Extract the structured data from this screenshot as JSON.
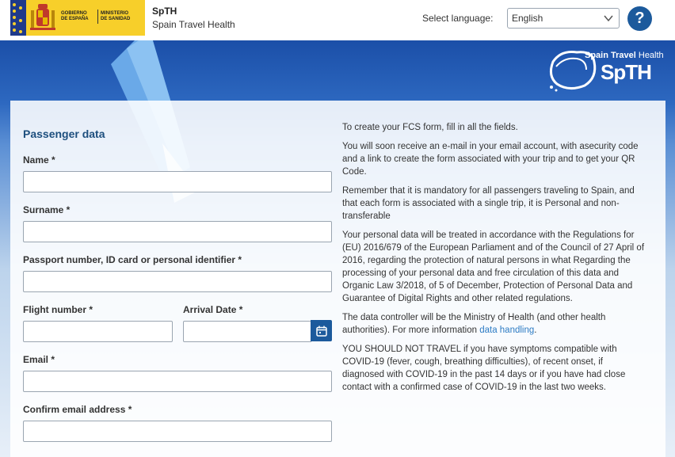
{
  "header": {
    "gov_logo_line1": "GOBIERNO\nDE ESPAÑA",
    "gov_logo_line2": "MINISTERIO\nDE SANIDAD",
    "app_title": "SpTH",
    "app_subtitle": "Spain Travel Health",
    "language_label": "Select language:",
    "language_value": "English",
    "help_label": "?"
  },
  "brand": {
    "top_bold": "Spain Travel",
    "top_light": "Health",
    "main": "SpTH"
  },
  "form": {
    "section_title": "Passenger data",
    "fields": {
      "name": "Name *",
      "surname": "Surname *",
      "passport": "Passport number, ID card or personal identifier *",
      "flight_number": "Flight number *",
      "arrival_date": "Arrival Date *",
      "email": "Email *",
      "confirm_email": "Confirm email address *"
    }
  },
  "info": {
    "p1": "To create your FCS form, fill in all the fields.",
    "p2": "You will soon receive an e-mail in your email account, with asecurity code and a link to create the form associated with your trip and to get your QR Code.",
    "p3": "Remember that it is mandatory for all passengers traveling to Spain, and that each form is associated with a single trip, it is Personal and non-transferable",
    "p4": "Your personal data will be treated in accordance with the Regulations for (EU) 2016/679 of the European Parliament and of the Council of 27 April of 2016, regarding the protection of natural persons in what Regarding the processing of your personal data and free circulation of this data and Organic Law 3/2018, of 5 of December, Protection of Personal Data and Guarantee of Digital Rights and other related regulations.",
    "p5_text": "The data controller will be the Ministry of Health (and other health authorities). For more information ",
    "p5_link": "data handling",
    "p5_end": ".",
    "p6": "YOU SHOULD NOT TRAVEL if you have symptoms compatible with COVID-19 (fever, cough, breathing difficulties), of recent onset, if diagnosed with COVID-19 in the past 14 days or if you have had close contact with a confirmed case of COVID-19 in the last two weeks."
  },
  "colors": {
    "primary": "#1c5a9c",
    "title": "#1d4f7e",
    "link": "#2c7bc4",
    "gov_yellow": "#f7cf2a"
  }
}
